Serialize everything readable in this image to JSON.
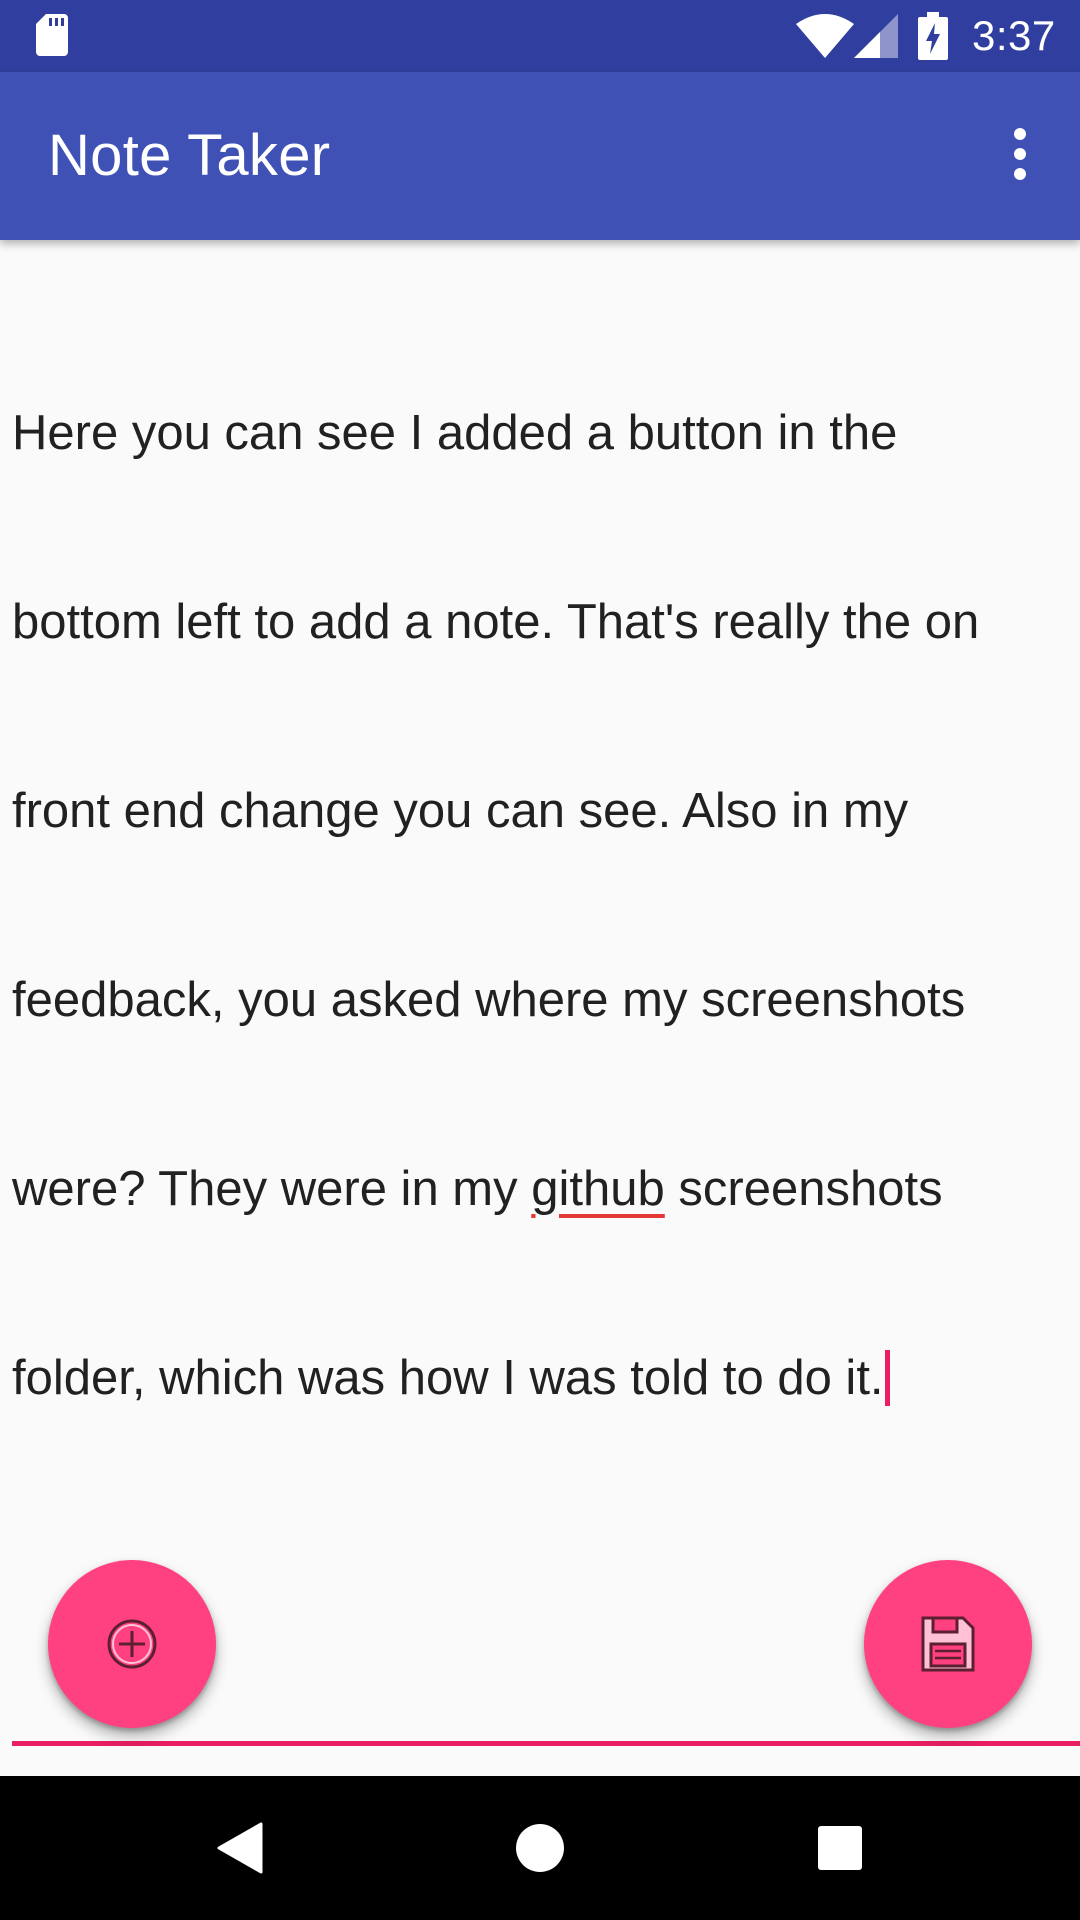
{
  "status_bar": {
    "time": "3:37",
    "icons": [
      "sd-card-icon",
      "wifi-icon",
      "cell-signal-icon",
      "battery-charging-icon"
    ]
  },
  "app_bar": {
    "title": "Note Taker",
    "overflow_icon": "more-vert-icon"
  },
  "editor": {
    "lines": [
      "Here you can see I added a button in the",
      "bottom left to add a note. That's really the on",
      "front end change you can see. Also in my",
      "feedback, you asked where my screenshots"
    ],
    "line5_before": "were? They were in my ",
    "line5_misspelled": "github",
    "line5_after": " screenshots",
    "line6": "folder, which was how I was told to do it.",
    "accent_color": "#e91e63",
    "spellcheck_color": "#e53935"
  },
  "fabs": {
    "add_icon": "add-circle-icon",
    "save_icon": "save-floppy-icon",
    "color": "#ff4081"
  },
  "nav_bar": {
    "icons": [
      "back-icon",
      "home-icon",
      "recents-icon"
    ]
  },
  "theme": {
    "primary": "#3f51b5",
    "primary_dark": "#303f9f",
    "background": "#fafafa"
  }
}
